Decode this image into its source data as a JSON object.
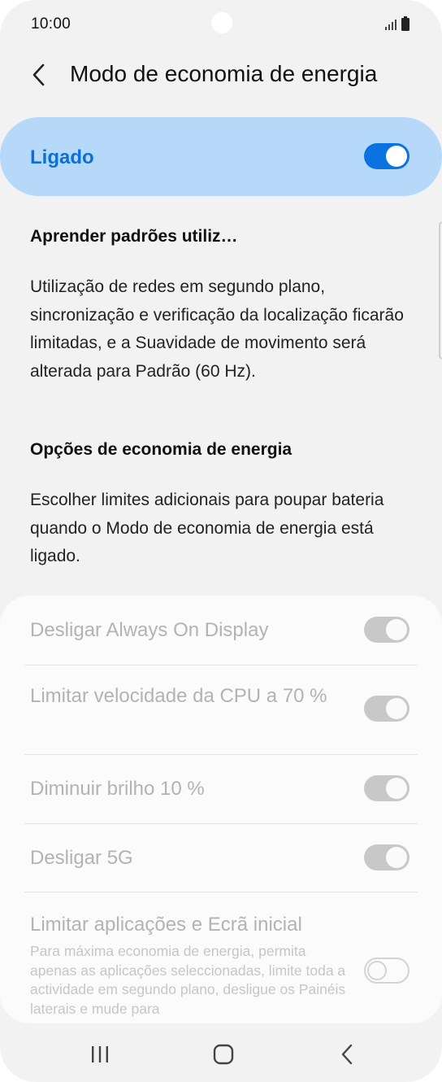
{
  "status_bar": {
    "time": "10:00",
    "icons": [
      "signal-icon",
      "battery-icon"
    ]
  },
  "header": {
    "back_icon": "chevron-left-icon",
    "title": "Modo de economia de energia"
  },
  "master": {
    "label": "Ligado",
    "enabled": true,
    "accent_color": "#0b73e0",
    "card_color": "#b6d9fa"
  },
  "adaptive": {
    "title": "Aprender padrões utiliz…"
  },
  "description": "Utilização de redes em segundo plano, sincronização e verificação da localização ficarão limitadas, e a Suavidade de movimento será alterada para Padrão (60 Hz).",
  "options_section": {
    "title": "Opções de economia de energia",
    "description": "Escolher limites adicionais para poupar bateria quando o Modo de economia de energia está ligado."
  },
  "options": [
    {
      "label": "Desligar Always On Display",
      "enabled": true,
      "dimmed": true
    },
    {
      "label": "Limitar velocidade da CPU a 70 %",
      "enabled": true,
      "dimmed": true
    },
    {
      "label": "Diminuir brilho 10 %",
      "enabled": true,
      "dimmed": true
    },
    {
      "label": "Desligar 5G",
      "enabled": true,
      "dimmed": true
    },
    {
      "label": "Limitar aplicações e Ecrã inicial",
      "description": "Para máxima economia de energia, permita apenas as aplicações seleccionadas, limite toda a actividade em segundo plano, desligue os Painéis laterais e mude para",
      "enabled": false,
      "dimmed": true
    }
  ],
  "navbar": {
    "icons": [
      "recent-apps-icon",
      "home-icon",
      "back-icon"
    ]
  }
}
